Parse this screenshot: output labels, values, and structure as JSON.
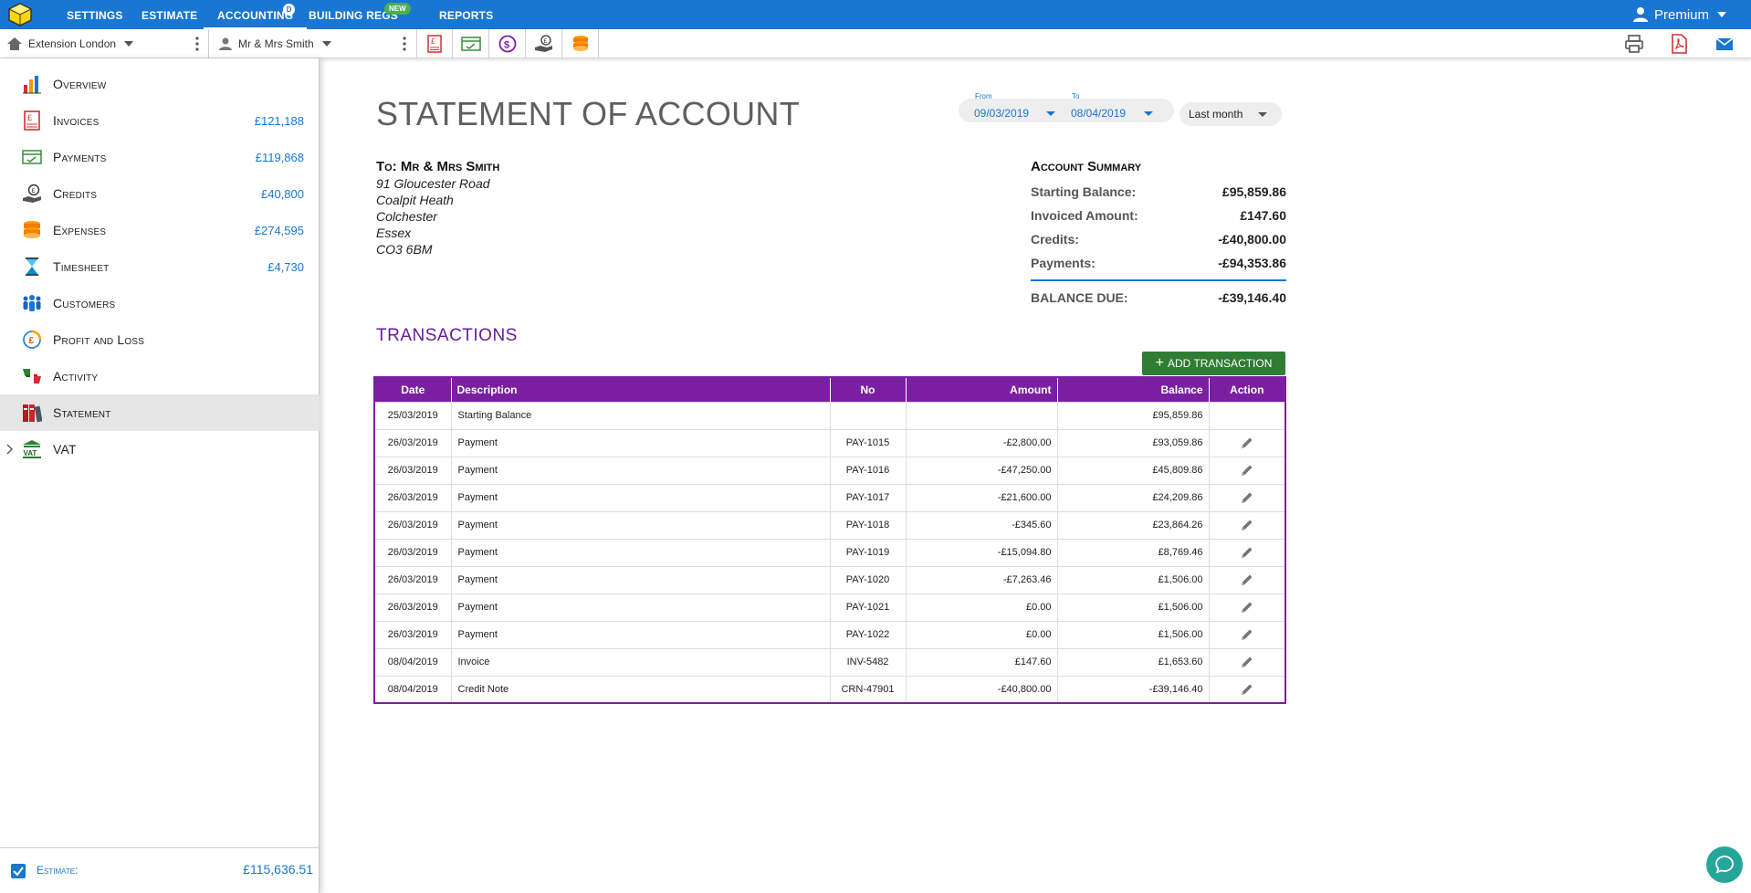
{
  "nav": {
    "tabs": [
      {
        "label": "SETTINGS"
      },
      {
        "label": "ESTIMATE"
      },
      {
        "label": "ACCOUNTING",
        "badge": "D"
      },
      {
        "label": "BUILDING REGS",
        "badge": "NEW"
      },
      {
        "label": "REPORTS"
      }
    ],
    "user": "Premium"
  },
  "toolbar": {
    "project": "Extension London",
    "customer": "Mr & Mrs Smith",
    "quick_icons": [
      "invoice-icon",
      "payment-icon",
      "credit-icon",
      "expense-icon",
      "coins-icon"
    ],
    "right_icons": [
      "print-icon",
      "pdf-icon",
      "email-icon"
    ]
  },
  "sidebar": {
    "items": [
      {
        "label": "Overview",
        "value": "",
        "icon": "overview-chart-icon"
      },
      {
        "label": "Invoices",
        "value": "£121,188",
        "icon": "invoice-icon"
      },
      {
        "label": "Payments",
        "value": "£119,868",
        "icon": "payment-icon"
      },
      {
        "label": "Credits",
        "value": "£40,800",
        "icon": "credit-icon"
      },
      {
        "label": "Expenses",
        "value": "£274,595",
        "icon": "expense-icon"
      },
      {
        "label": "Timesheet",
        "value": "£4,730",
        "icon": "timesheet-icon"
      },
      {
        "label": "Customers",
        "value": "",
        "icon": "customers-icon"
      },
      {
        "label": "Profit and Loss",
        "value": "",
        "icon": "profit-loss-icon"
      },
      {
        "label": "Activity",
        "value": "",
        "icon": "activity-icon"
      },
      {
        "label": "Statement",
        "value": "",
        "icon": "statement-icon",
        "active": true
      },
      {
        "label": "VAT",
        "value": "",
        "icon": "vat-icon"
      }
    ],
    "footer": {
      "label": "Estimate:",
      "value": "£115,636.51",
      "checked": true
    }
  },
  "statement": {
    "title": "STATEMENT OF ACCOUNT",
    "from_label": "From",
    "from_date": "09/03/2019",
    "to_label": "To",
    "to_date": "08/04/2019",
    "period": "Last month",
    "to_name": "To: Mr & Mrs Smith",
    "address": [
      "91 Gloucester Road",
      "Coalpit Heath",
      "Colchester",
      "Essex",
      "CO3  6BM"
    ]
  },
  "summary": {
    "title": "Account Summary",
    "rows": [
      {
        "label": "Starting Balance:",
        "value": "£95,859.86"
      },
      {
        "label": "Invoiced Amount:",
        "value": "£147.60"
      },
      {
        "label": "Credits:",
        "value": "-£40,800.00"
      },
      {
        "label": "Payments:",
        "value": "-£94,353.86"
      }
    ],
    "due_label": "BALANCE DUE:",
    "due_value": "-£39,146.40"
  },
  "transactions": {
    "title": "TRANSACTIONS",
    "add_label": "ADD TRANSACTION",
    "headers": [
      "Date",
      "Description",
      "No",
      "Amount",
      "Balance",
      "Action"
    ],
    "rows": [
      {
        "date": "25/03/2019",
        "desc": "Starting Balance",
        "no": "",
        "amount": "",
        "balance": "£95,859.86",
        "amount_neg": false,
        "balance_neg": false,
        "editable": false
      },
      {
        "date": "26/03/2019",
        "desc": "Payment",
        "no": "PAY-1015",
        "amount": "-£2,800.00",
        "balance": "£93,059.86",
        "amount_neg": true,
        "balance_neg": false,
        "editable": true
      },
      {
        "date": "26/03/2019",
        "desc": "Payment",
        "no": "PAY-1016",
        "amount": "-£47,250.00",
        "balance": "£45,809.86",
        "amount_neg": true,
        "balance_neg": false,
        "editable": true
      },
      {
        "date": "26/03/2019",
        "desc": "Payment",
        "no": "PAY-1017",
        "amount": "-£21,600.00",
        "balance": "£24,209.86",
        "amount_neg": true,
        "balance_neg": false,
        "editable": true
      },
      {
        "date": "26/03/2019",
        "desc": "Payment",
        "no": "PAY-1018",
        "amount": "-£345.60",
        "balance": "£23,864.26",
        "amount_neg": true,
        "balance_neg": false,
        "editable": true
      },
      {
        "date": "26/03/2019",
        "desc": "Payment",
        "no": "PAY-1019",
        "amount": "-£15,094.80",
        "balance": "£8,769.46",
        "amount_neg": true,
        "balance_neg": false,
        "editable": true
      },
      {
        "date": "26/03/2019",
        "desc": "Payment",
        "no": "PAY-1020",
        "amount": "-£7,263.46",
        "balance": "£1,506.00",
        "amount_neg": true,
        "balance_neg": false,
        "editable": true
      },
      {
        "date": "26/03/2019",
        "desc": "Payment",
        "no": "PAY-1021",
        "amount": "£0.00",
        "balance": "£1,506.00",
        "amount_neg": false,
        "balance_neg": false,
        "editable": true
      },
      {
        "date": "26/03/2019",
        "desc": "Payment",
        "no": "PAY-1022",
        "amount": "£0.00",
        "balance": "£1,506.00",
        "amount_neg": false,
        "balance_neg": false,
        "editable": true
      },
      {
        "date": "08/04/2019",
        "desc": "Invoice",
        "no": "INV-5482",
        "amount": "£147.60",
        "balance": "£1,653.60",
        "amount_neg": false,
        "balance_neg": false,
        "editable": true
      },
      {
        "date": "08/04/2019",
        "desc": "Credit Note",
        "no": "CRN-47901",
        "amount": "-£40,800.00",
        "balance": "-£39,146.40",
        "amount_neg": true,
        "balance_neg": true,
        "editable": true
      }
    ]
  },
  "colors": {
    "accent": "#1976d2",
    "table": "#7b1fa2",
    "negative": "#e53935",
    "add": "#2e7d32"
  }
}
